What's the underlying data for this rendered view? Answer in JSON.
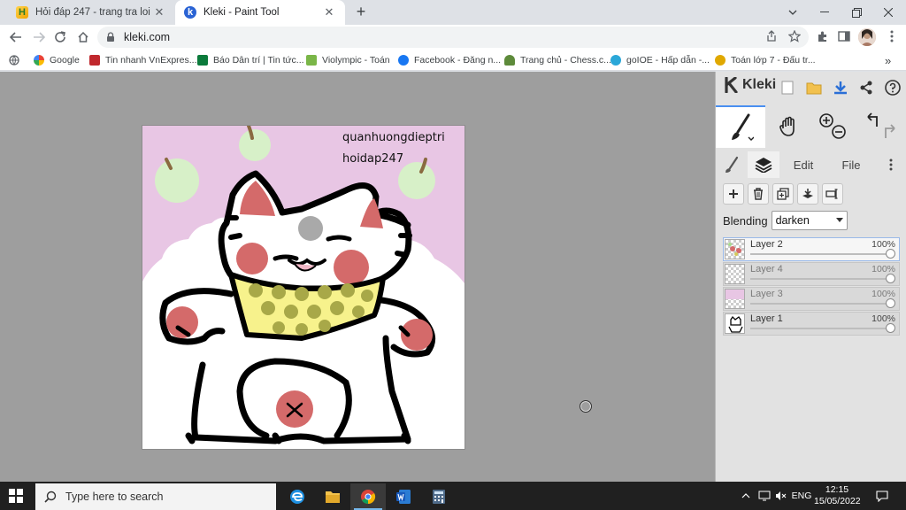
{
  "browser": {
    "tabs": [
      {
        "title": "Hỏi đáp 247 - trang tra loi",
        "active": false
      },
      {
        "title": "Kleki - Paint Tool",
        "active": true
      }
    ],
    "url": "kleki.com",
    "bookmarks": [
      {
        "label": "Google",
        "color": "#4285f4"
      },
      {
        "label": "Tin nhanh VnExpres...",
        "color": "#c0282d"
      },
      {
        "label": "Báo Dân trí | Tin tức...",
        "color": "#0b7a3b"
      },
      {
        "label": "Violympic - Toán",
        "color": "#7ab648"
      },
      {
        "label": "Facebook - Đăng n...",
        "color": "#1877f2"
      },
      {
        "label": "Trang chủ - Chess.c...",
        "color": "#5d8a3a"
      },
      {
        "label": "goIOE - Hấp dẫn -...",
        "color": "#2aa7d8"
      },
      {
        "label": "Toán lớp 7 - Đấu tr...",
        "color": "#e0a800"
      }
    ]
  },
  "kleki": {
    "logo_text": "Kleki",
    "tabs": [
      {
        "label": "Edit"
      },
      {
        "label": "File"
      }
    ],
    "blending_label": "Blending",
    "blending_value": "darken",
    "layers": [
      {
        "name": "Layer 2",
        "opacity": "100%",
        "selected": true
      },
      {
        "name": "Layer 4",
        "opacity": "100%",
        "selected": false
      },
      {
        "name": "Layer 3",
        "opacity": "100%",
        "selected": false
      },
      {
        "name": "Layer 1",
        "opacity": "100%",
        "selected": false
      }
    ],
    "canvas_text": [
      "quanhuongdieptri",
      "hoidap247"
    ],
    "colors": {
      "accent": "#4a8ff0",
      "canvas_bg_pink": "#e8c6e4",
      "apple_green": "#d7f0c8",
      "cheek_red": "#d46a6a",
      "bib_yellow": "#f7f28c",
      "bib_dots": "#a8a848"
    }
  },
  "taskbar": {
    "search_placeholder": "Type here to search",
    "language": "ENG",
    "time": "12:15",
    "date": "15/05/2022"
  }
}
